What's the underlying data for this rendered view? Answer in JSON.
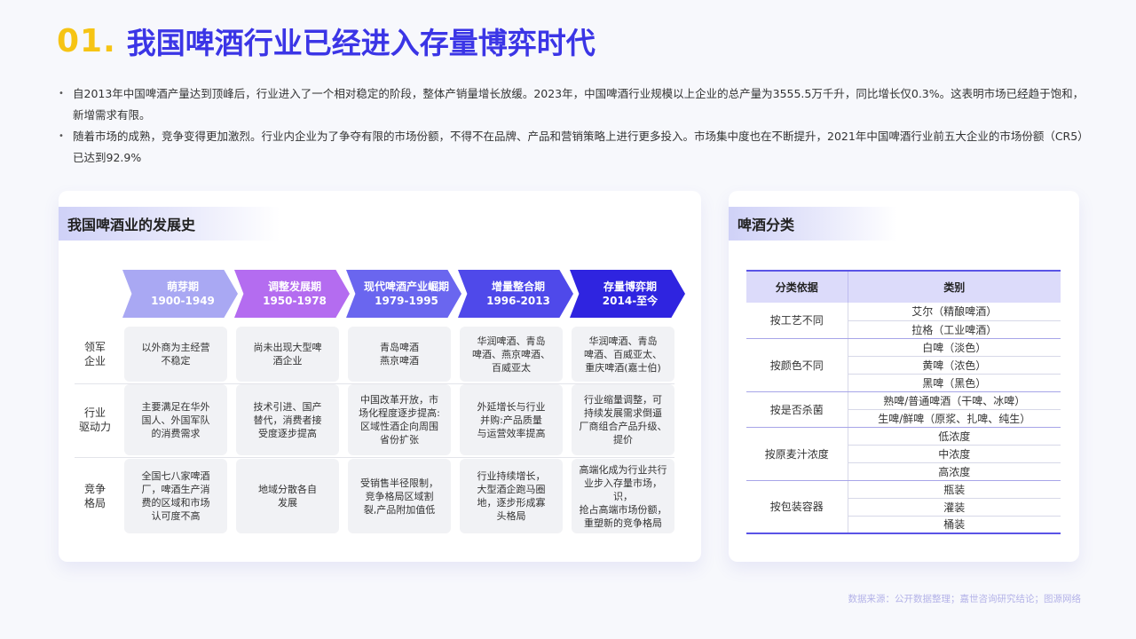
{
  "title": {
    "number": "01.",
    "text": "我国啤酒行业已经进入存量博弈时代"
  },
  "bullets": [
    "自2013年中国啤酒产量达到顶峰后，行业进入了一个相对稳定的阶段，整体产销量增长放缓。2023年，中国啤酒行业规模以上企业的总产量为3555.5万千升，同比增长仅0.3%。这表明市场已经趋于饱和，新增需求有限。",
    "随着市场的成熟，竞争变得更加激烈。行业内企业为了争夺有限的市场份额，不得不在品牌、产品和营销策略上进行更多投入。市场集中度也在不断提升，2021年中国啤酒行业前五大企业的市场份额（CR5）已达到92.9%"
  ],
  "history": {
    "heading": "我国啤酒业的发展史",
    "stages": [
      {
        "name": "萌芽期",
        "years": "1900-1949",
        "color": "#a9a8f3"
      },
      {
        "name": "调整发展期",
        "years": "1950-1978",
        "color": "#b46cf0"
      },
      {
        "name": "现代啤酒产业崛期",
        "years": "1979-1995",
        "color": "#6a66ef"
      },
      {
        "name": "增量整合期",
        "years": "1996-2013",
        "color": "#4f49ea"
      },
      {
        "name": "存量博弈期",
        "years": "2014-至今",
        "color": "#2f24e0"
      }
    ],
    "rows": [
      {
        "label": "领军\n企业",
        "cells": [
          "以外商为主经营\n不稳定",
          "尚未出现大型啤\n酒企业",
          "青岛啤酒\n燕京啤酒",
          "华润啤酒、青岛\n啤酒、燕京啤酒、\n百威亚太",
          "华润啤酒、青岛\n啤酒、百威亚太、\n重庆啤酒(嘉士伯)"
        ]
      },
      {
        "label": "行业\n驱动力",
        "cells": [
          "主要满足在华外\n国人、外国军队\n的消费需求",
          "技术引进、国产\n替代，消费者接\n受度逐步提高",
          "中国改革开放，市\n场化程度逐步提高:\n区域性酒企向周围\n省份扩张",
          "外延增长与行业\n并购:产品质量\n与运营效率提高",
          "行业缩量调整，可\n持续发展需求倒逼\n厂商组合产品升级、\n提价"
        ]
      },
      {
        "label": "竞争\n格局",
        "cells": [
          "全国七八家啤酒\n厂，啤酒生产消\n费的区域和市场\n认可度不高",
          "地域分散各自\n发展",
          "受销售半径限制，\n竞争格局区域割\n裂,产品附加值低",
          "行业持续增长，\n大型酒企跑马圈\n地，逐步形成寡\n头格局",
          "高端化成为行业共行\n业步入存量市场，识，\n抢占高端市场份额，\n重塑新的竞争格局"
        ]
      }
    ]
  },
  "classification": {
    "heading": "啤酒分类",
    "headers": [
      "分类依据",
      "类别"
    ],
    "groups": [
      {
        "basis": "按工艺不同",
        "items": [
          "艾尔（精酿啤酒）",
          "拉格（工业啤酒）"
        ]
      },
      {
        "basis": "按颜色不同",
        "items": [
          "白啤（淡色）",
          "黄啤（浓色）",
          "黑啤（黑色）"
        ]
      },
      {
        "basis": "按是否杀菌",
        "items": [
          "熟啤/普通啤酒（干啤、冰啤）",
          "生啤/鲜啤（原浆、扎啤、纯生）"
        ]
      },
      {
        "basis": "按原麦汁浓度",
        "items": [
          "低浓度",
          "中浓度",
          "高浓度"
        ]
      },
      {
        "basis": "按包装容器",
        "items": [
          "瓶装",
          "灌装",
          "桶装"
        ]
      }
    ]
  },
  "source": "数据来源：公开数据整理；嘉世咨询研究结论；图源网络",
  "colors": {
    "title_number": "#f6c414",
    "title_text": "#3b35e6",
    "accent": "#5a54e6"
  }
}
